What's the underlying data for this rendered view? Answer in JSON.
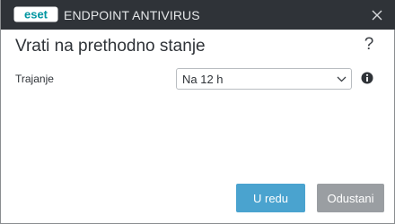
{
  "titlebar": {
    "logo_text": "eset",
    "product_name": "ENDPOINT ANTIVIRUS",
    "close_icon": "close-icon"
  },
  "dialog": {
    "title": "Vrati na prethodno stanje",
    "help_label": "?",
    "duration_label": "Trajanje",
    "duration_value": "Na 12 h",
    "info_icon": "info-icon"
  },
  "buttons": {
    "ok_label": "U redu",
    "cancel_label": "Odustani"
  },
  "colors": {
    "titlebar_bg": "#2f3338",
    "primary_button": "#4aa3cf",
    "secondary_button": "#9a9ea2",
    "logo_teal": "#0096a1"
  }
}
